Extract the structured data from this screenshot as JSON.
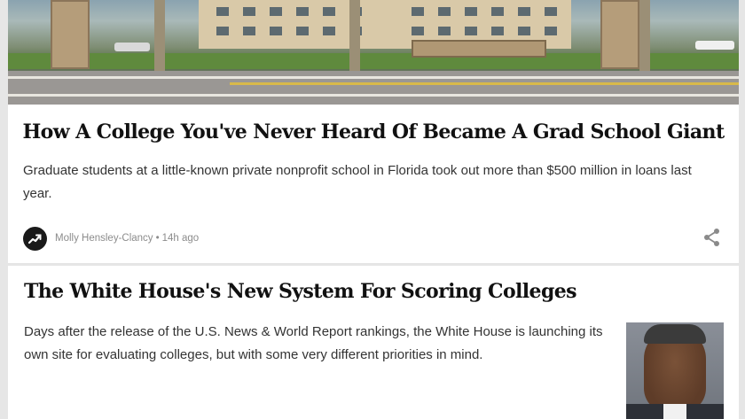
{
  "articles": [
    {
      "headline": "How A College You've Never Heard Of Became A Grad School Giant",
      "description": "Graduate students at a little-known private nonprofit school in Florida took out more than $500 million in loans last year.",
      "author": "Molly Hensley-Clancy",
      "separator": "•",
      "time": "14h ago",
      "image_icon": "campus-photo",
      "avatar_icon": "trending-arrow-icon",
      "share_icon": "share-icon"
    },
    {
      "headline": "The White House's New System For Scoring Colleges",
      "description": "Days after the release of the U.S. News & World Report rankings, the White House is launching its own site for evaluating colleges, but with some very different priorities in mind.",
      "image_icon": "portrait-photo"
    }
  ],
  "colors": {
    "background": "#e6e6e6",
    "card": "#ffffff",
    "headline": "#111111",
    "body_text": "#333333",
    "meta_text": "#8c8c8c"
  }
}
